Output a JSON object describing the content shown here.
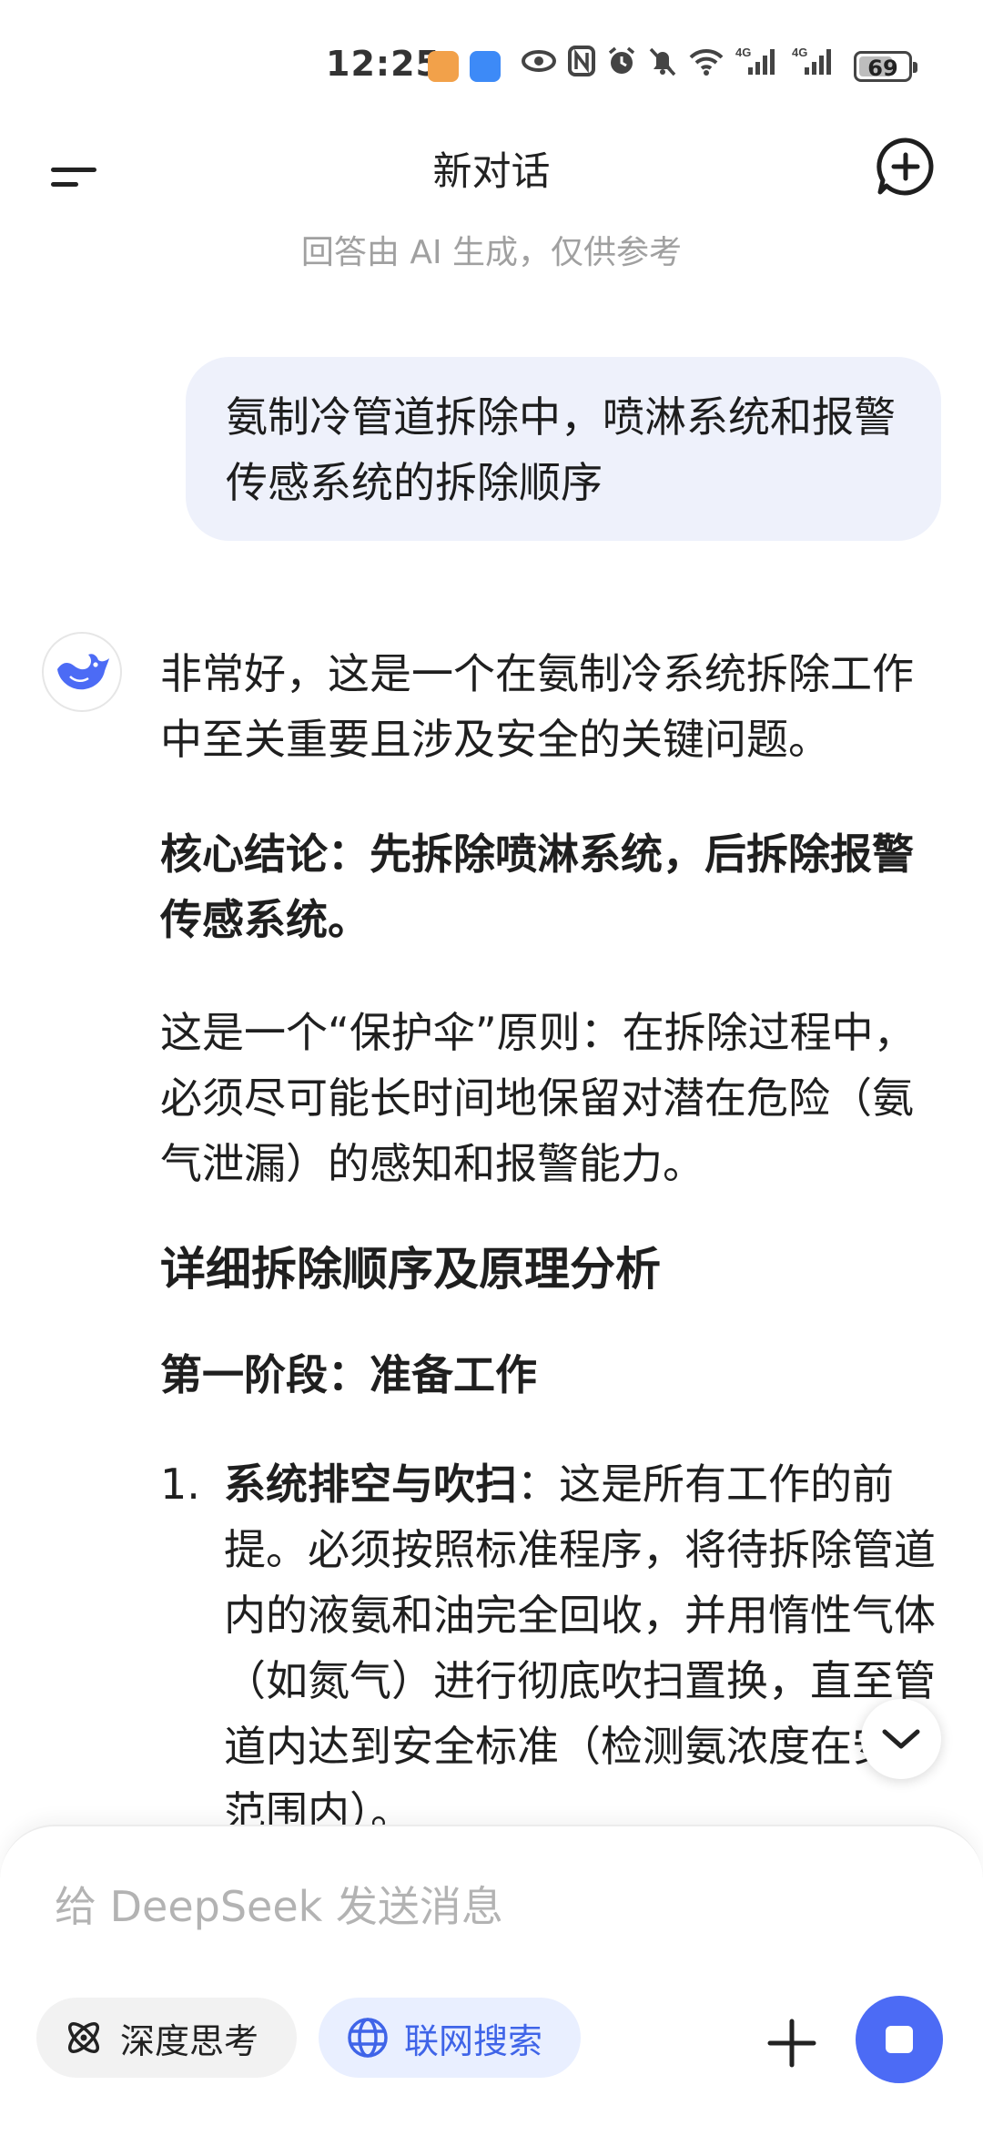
{
  "status_bar": {
    "time": "12:25",
    "battery": "69",
    "battery_level_percent": 69,
    "network_labels": [
      "4G",
      "4G"
    ]
  },
  "header": {
    "title": "新对话",
    "subtitle": "回答由 AI 生成，仅供参考"
  },
  "conversation": {
    "user_message": "氨制冷管道拆除中，喷淋系统和报警传感系统的拆除顺序",
    "assistant": {
      "intro": "非常好，这是一个在氨制冷系统拆除工作中至关重要且涉及安全的关键问题。",
      "conclusion": "核心结论：先拆除喷淋系统，后拆除报警传感系统。",
      "principle": "这是一个“保护伞”原则：在拆除过程中，必须尽可能长时间地保留对潜在危险（氨气泄漏）的感知和报警能力。",
      "section_heading": "详细拆除顺序及原理分析",
      "phase_heading": "第一阶段：准备工作",
      "list": [
        {
          "number": "1.",
          "title": "系统排空与吹扫",
          "text": "：这是所有工作的前提。必须按照标准程序，将待拆除管道内的液氨和油完全回收，并用惰性气体（如氮气）进行彻底吹扫置换，直至管道内达到安全标准（检测氨浓度在安全范围内）。"
        }
      ]
    }
  },
  "composer": {
    "placeholder": "给 DeepSeek 发送消息",
    "deep_think_label": "深度思考",
    "web_search_label": "联网搜索"
  },
  "colors": {
    "accent": "#4c6bf5",
    "user_bubble": "#eef1fb",
    "web_chip_bg": "#e9efff",
    "web_chip_text": "#3f64e8",
    "muted_text": "#a0a0a0"
  },
  "icons": [
    "menu-icon",
    "new-chat-icon",
    "deepseek-whale-icon",
    "chevron-down-icon",
    "atom-icon",
    "globe-icon",
    "plus-icon",
    "stop-icon"
  ]
}
